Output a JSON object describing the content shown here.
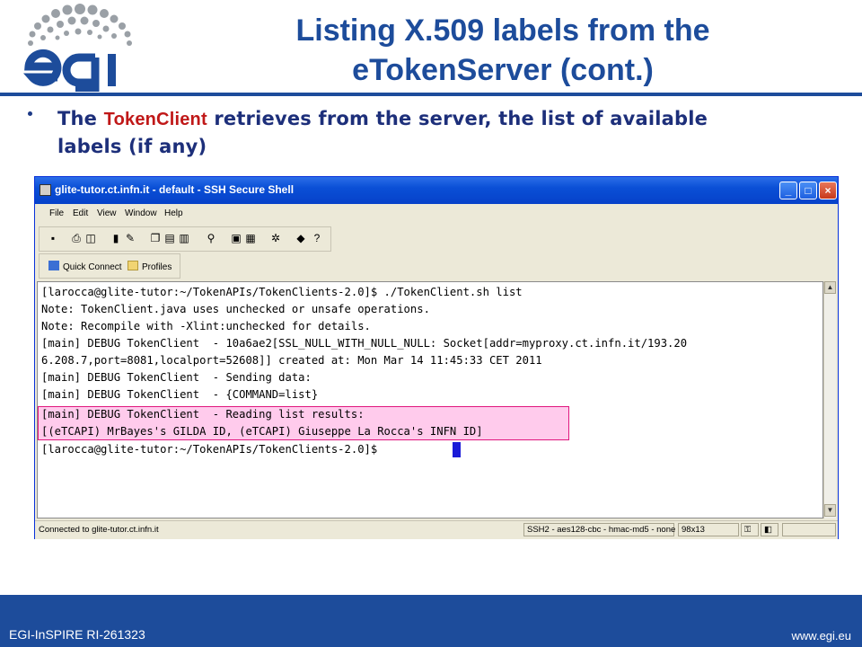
{
  "slide": {
    "logo_text": "egi",
    "title_line1": "Listing X.509 labels from the",
    "title_line2": "eTokenServer (cont.)",
    "bullet_prefix": "The ",
    "bullet_highlight": "TokenClient",
    "bullet_rest_line1": " retrieves from the server, the list of available",
    "bullet_line2": "labels (if any)"
  },
  "window": {
    "title": "glite-tutor.ct.infn.it - default - SSH Secure Shell",
    "menu": [
      "File",
      "Edit",
      "View",
      "Window",
      "Help"
    ],
    "toolbar_icons": [
      "save-icon",
      "print-icon",
      "print-preview-icon",
      "find-icon",
      "paste-icon",
      "copy-icon",
      "cut-icon",
      "binoculars-icon",
      "new-terminal-icon",
      "new-file-transfer-icon",
      "settings-icon",
      "help-icon",
      "context-help-icon"
    ],
    "quick_connect_label": "Quick Connect",
    "profiles_label": "Profiles",
    "terminal_lines": [
      "[larocca@glite-tutor:~/TokenAPIs/TokenClients-2.0]$ ./TokenClient.sh list",
      "Note: TokenClient.java uses unchecked or unsafe operations.",
      "Note: Recompile with -Xlint:unchecked for details.",
      "[main] DEBUG TokenClient  - 10a6ae2[SSL_NULL_WITH_NULL_NULL: Socket[addr=myproxy.ct.infn.it/193.20",
      "6.208.7,port=8081,localport=52608]] created at: Mon Mar 14 11:45:33 CET 2011",
      "[main] DEBUG TokenClient  - Sending data:",
      "[main] DEBUG TokenClient  - {COMMAND=list}",
      "[main] DEBUG TokenClient  - Reading list results:",
      "[(eTCAPI) MrBayes's GILDA ID, (eTCAPI) Giuseppe La Rocca's INFN ID]",
      "[larocca@glite-tutor:~/TokenAPIs/TokenClients-2.0]$ "
    ],
    "status": {
      "connection": "Connected to glite-tutor.ct.infn.it",
      "cipher": "SSH2 - aes128-cbc - hmac-md5 - none",
      "size": "98x13"
    }
  },
  "footer": {
    "left": "EGI-InSPIRE RI-261323",
    "right": "www.egi.eu"
  },
  "colors": {
    "brand_blue": "#1d4c9b",
    "highlight_red": "#c01818",
    "terminal_highlight": "#ffa0dc",
    "cursor_blue": "#1b1bd8"
  }
}
